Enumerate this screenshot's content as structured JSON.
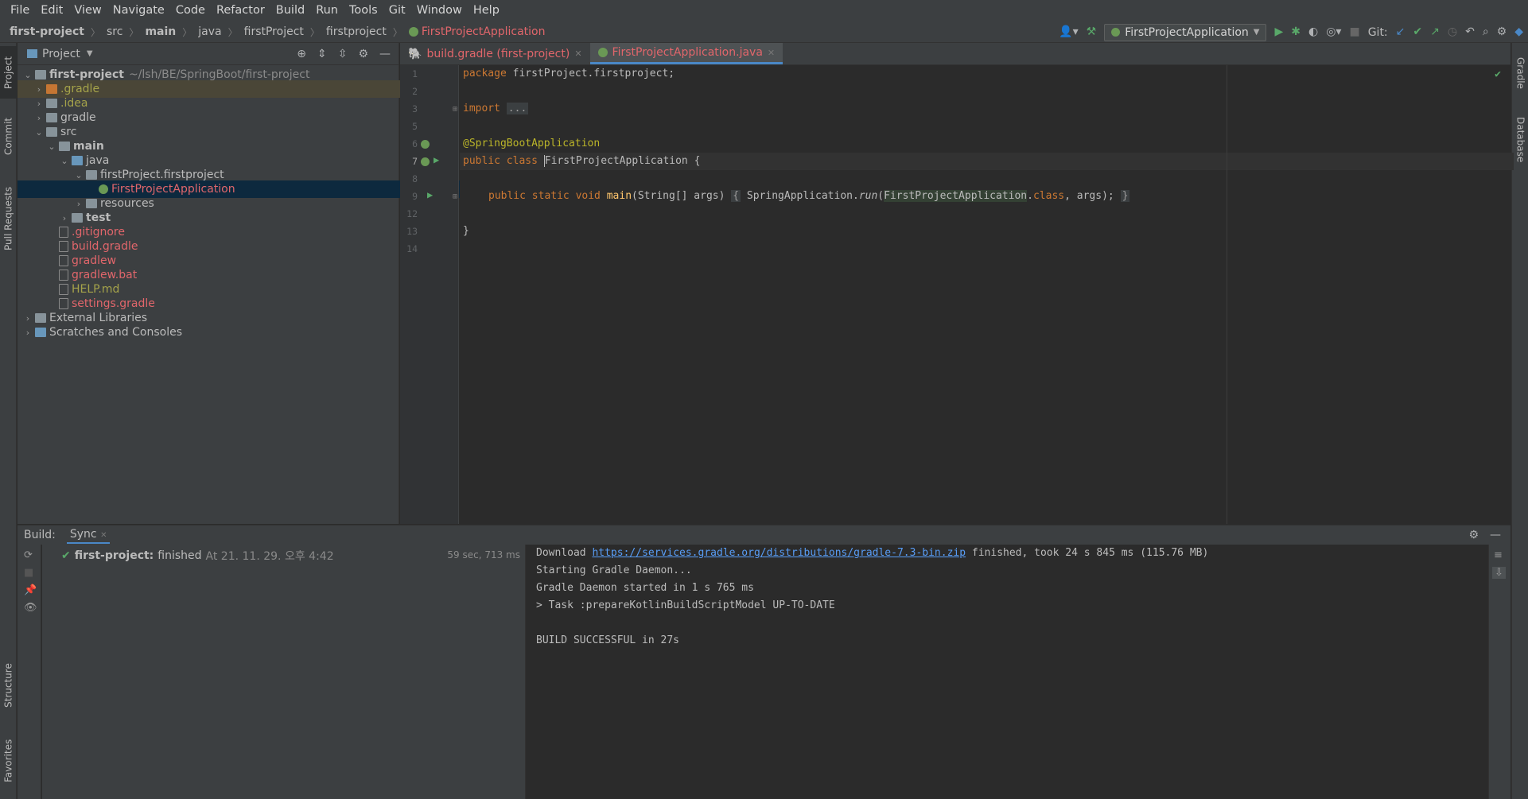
{
  "menu": [
    "File",
    "Edit",
    "View",
    "Navigate",
    "Code",
    "Refactor",
    "Build",
    "Run",
    "Tools",
    "Git",
    "Window",
    "Help"
  ],
  "breadcrumb": [
    "first-project",
    "src",
    "main",
    "java",
    "firstProject",
    "firstproject",
    "FirstProjectApplication"
  ],
  "toolbar": {
    "run_config": "FirstProjectApplication",
    "git_label": "Git:"
  },
  "left_strip": [
    "Project",
    "Commit",
    "Pull Requests",
    "Structure",
    "Favorites"
  ],
  "right_strip": [
    "Gradle",
    "Database"
  ],
  "project_panel": {
    "title": "Project",
    "root": {
      "name": "first-project",
      "path": "~/lsh/BE/SpringBoot/first-project"
    },
    "items": [
      ".gradle",
      ".idea",
      "gradle",
      "src",
      "main",
      "java",
      "firstProject.firstproject",
      "FirstProjectApplication",
      "resources",
      "test",
      ".gitignore",
      "build.gradle",
      "gradlew",
      "gradlew.bat",
      "HELP.md",
      "settings.gradle",
      "External Libraries",
      "Scratches and Consoles"
    ]
  },
  "editor": {
    "tabs": [
      "build.gradle (first-project)",
      "FirstProjectApplication.java"
    ],
    "line_numbers": [
      "1",
      "2",
      "3",
      "5",
      "6",
      "7",
      "8",
      "9",
      "12",
      "13",
      "14"
    ],
    "code": {
      "l1_kw": "package",
      "l1_rest": " firstProject.firstproject;",
      "l3_kw": "import",
      "l3_fold": "...",
      "l6_ann": "@SpringBootApplication",
      "l7_kw": "public class ",
      "l7_cls": "FirstProjectApplication",
      "l7_rest": " {",
      "l9_kw": "public static void ",
      "l9_fn": "main",
      "l9_args": "(String[] args) ",
      "l9_open": "{",
      "l9_call": " SpringApplication.",
      "l9_run": "run",
      "l9_p1": "(",
      "l9_cls": "FirstProjectApplication",
      "l9_dot": ".",
      "l9_classkw": "class",
      "l9_p2": ", args); ",
      "l9_close": "}",
      "l13": "}"
    }
  },
  "build": {
    "label": "Build:",
    "tab": "Sync",
    "result_name": "first-project:",
    "result_status": "finished",
    "result_time": "At 21. 11. 29. 오후 4:42",
    "duration": "59 sec, 713 ms",
    "console": {
      "dl_prefix": "Download ",
      "dl_url": "https://services.gradle.org/distributions/gradle-7.3-bin.zip",
      "dl_suffix": " finished, took 24 s 845 ms (115.76 MB)",
      "line2": "Starting Gradle Daemon...",
      "line3": "Gradle Daemon started in 1 s 765 ms",
      "line4": "> Task :prepareKotlinBuildScriptModel UP-TO-DATE",
      "line5": "BUILD SUCCESSFUL in 27s"
    }
  },
  "colors": {
    "accent": "#4a88c7",
    "selection": "#0d293e",
    "red_text": "#e1666b",
    "green": "#59a869"
  }
}
